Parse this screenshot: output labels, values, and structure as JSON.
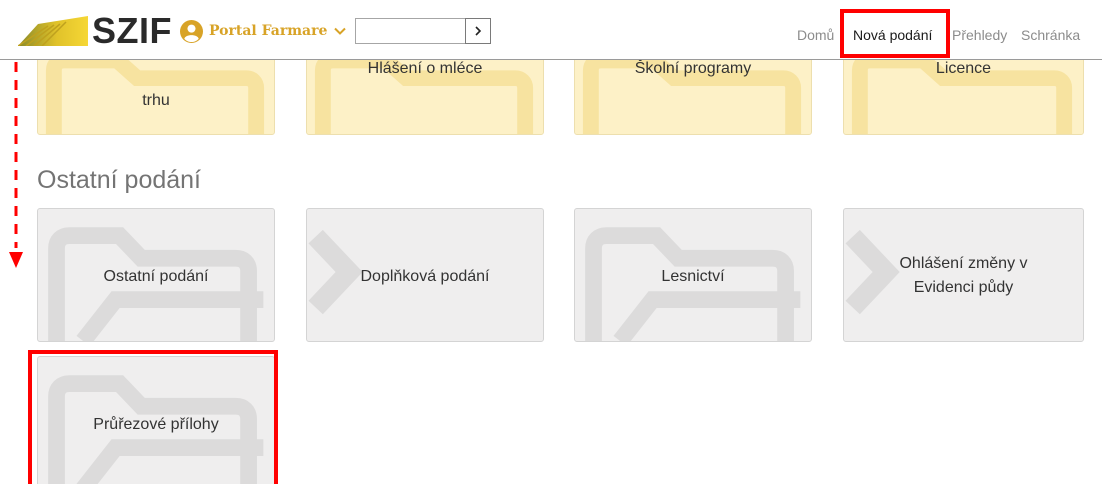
{
  "header": {
    "brand": "SZIF",
    "portal_label": "Portal Farmare",
    "search": {
      "value": "",
      "placeholder": ""
    },
    "nav": [
      {
        "label": "Domů",
        "active": false
      },
      {
        "label": "Nová podání",
        "active": true
      },
      {
        "label": "Přehledy",
        "active": false
      },
      {
        "label": "Schránka",
        "active": false
      }
    ]
  },
  "top_tiles": [
    {
      "label_line1": "",
      "label_line2": "trhu"
    },
    {
      "label_line1": "Hlášení o mléce",
      "label_line2": ""
    },
    {
      "label_line1": "Školní programy",
      "label_line2": ""
    },
    {
      "label_line1": "Licence",
      "label_line2": ""
    }
  ],
  "section": {
    "title": "Ostatní podání",
    "tiles": [
      {
        "label_line1": "Ostatní podání",
        "label_line2": ""
      },
      {
        "label_line1": "Doplňková podání",
        "label_line2": ""
      },
      {
        "label_line1": "Lesnictví",
        "label_line2": ""
      },
      {
        "label_line1": "Ohlášení změny v",
        "label_line2": "Evidenci půdy"
      },
      {
        "label_line1": "Průřezové přílohy",
        "label_line2": ""
      }
    ]
  },
  "colors": {
    "brand_gold": "#d8a327",
    "highlight_red": "#ff0000",
    "tile_yellow": "#fdf1c7",
    "tile_gray": "#efeeee"
  }
}
